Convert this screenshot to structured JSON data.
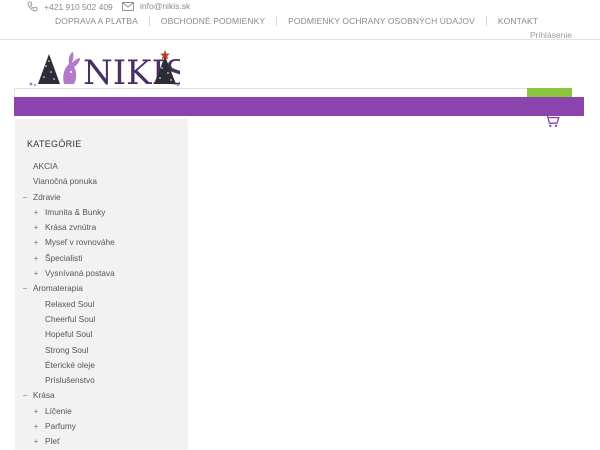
{
  "topbar": {
    "phone": "+421 910 502 409",
    "email": "info@nikis.sk",
    "nav": [
      "DOPRAVA A PLATBA",
      "OBCHODNÉ PODMIENKY",
      "PODMIENKY OCHRANY OSOBNÝCH ÚDAJOV",
      "KONTAKT"
    ],
    "login": "Prihlásenie"
  },
  "logo": {
    "text": "NIKIS"
  },
  "colors": {
    "brand_purple": "#8b44ad",
    "search_green": "#8cc63f",
    "sidebar_bg": "#f2f2f2"
  },
  "sidebar": {
    "title": "KATEGÓRIE",
    "items": [
      {
        "label": "AKCIA",
        "level": 0,
        "toggle": ""
      },
      {
        "label": "Vianočná ponuka",
        "level": 0,
        "toggle": ""
      },
      {
        "label": "Zdravie",
        "level": 0,
        "toggle": "−"
      },
      {
        "label": "Imunita & Bunky",
        "level": 1,
        "toggle": "+"
      },
      {
        "label": "Krása zvnútra",
        "level": 1,
        "toggle": "+"
      },
      {
        "label": "Myseľ v rovnováhe",
        "level": 1,
        "toggle": "+"
      },
      {
        "label": "Špecialisti",
        "level": 1,
        "toggle": "+"
      },
      {
        "label": "Vysnívaná postava",
        "level": 1,
        "toggle": "+"
      },
      {
        "label": "Aromaterapia",
        "level": 0,
        "toggle": "−"
      },
      {
        "label": "Relaxed Soul",
        "level": 1,
        "toggle": ""
      },
      {
        "label": "Cheerful Soul",
        "level": 1,
        "toggle": ""
      },
      {
        "label": "Hopeful Soul",
        "level": 1,
        "toggle": ""
      },
      {
        "label": "Strong Soul",
        "level": 1,
        "toggle": ""
      },
      {
        "label": "Éterické oleje",
        "level": 1,
        "toggle": ""
      },
      {
        "label": "Príslušenstvo",
        "level": 1,
        "toggle": ""
      },
      {
        "label": "Krása",
        "level": 0,
        "toggle": "−"
      },
      {
        "label": "Líčenie",
        "level": 1,
        "toggle": "+"
      },
      {
        "label": "Parfumy",
        "level": 1,
        "toggle": "+"
      },
      {
        "label": "Pleť",
        "level": 1,
        "toggle": "+"
      }
    ]
  },
  "icons": {
    "phone": "phone-icon",
    "mail": "mail-icon",
    "cart": "cart-icon"
  }
}
